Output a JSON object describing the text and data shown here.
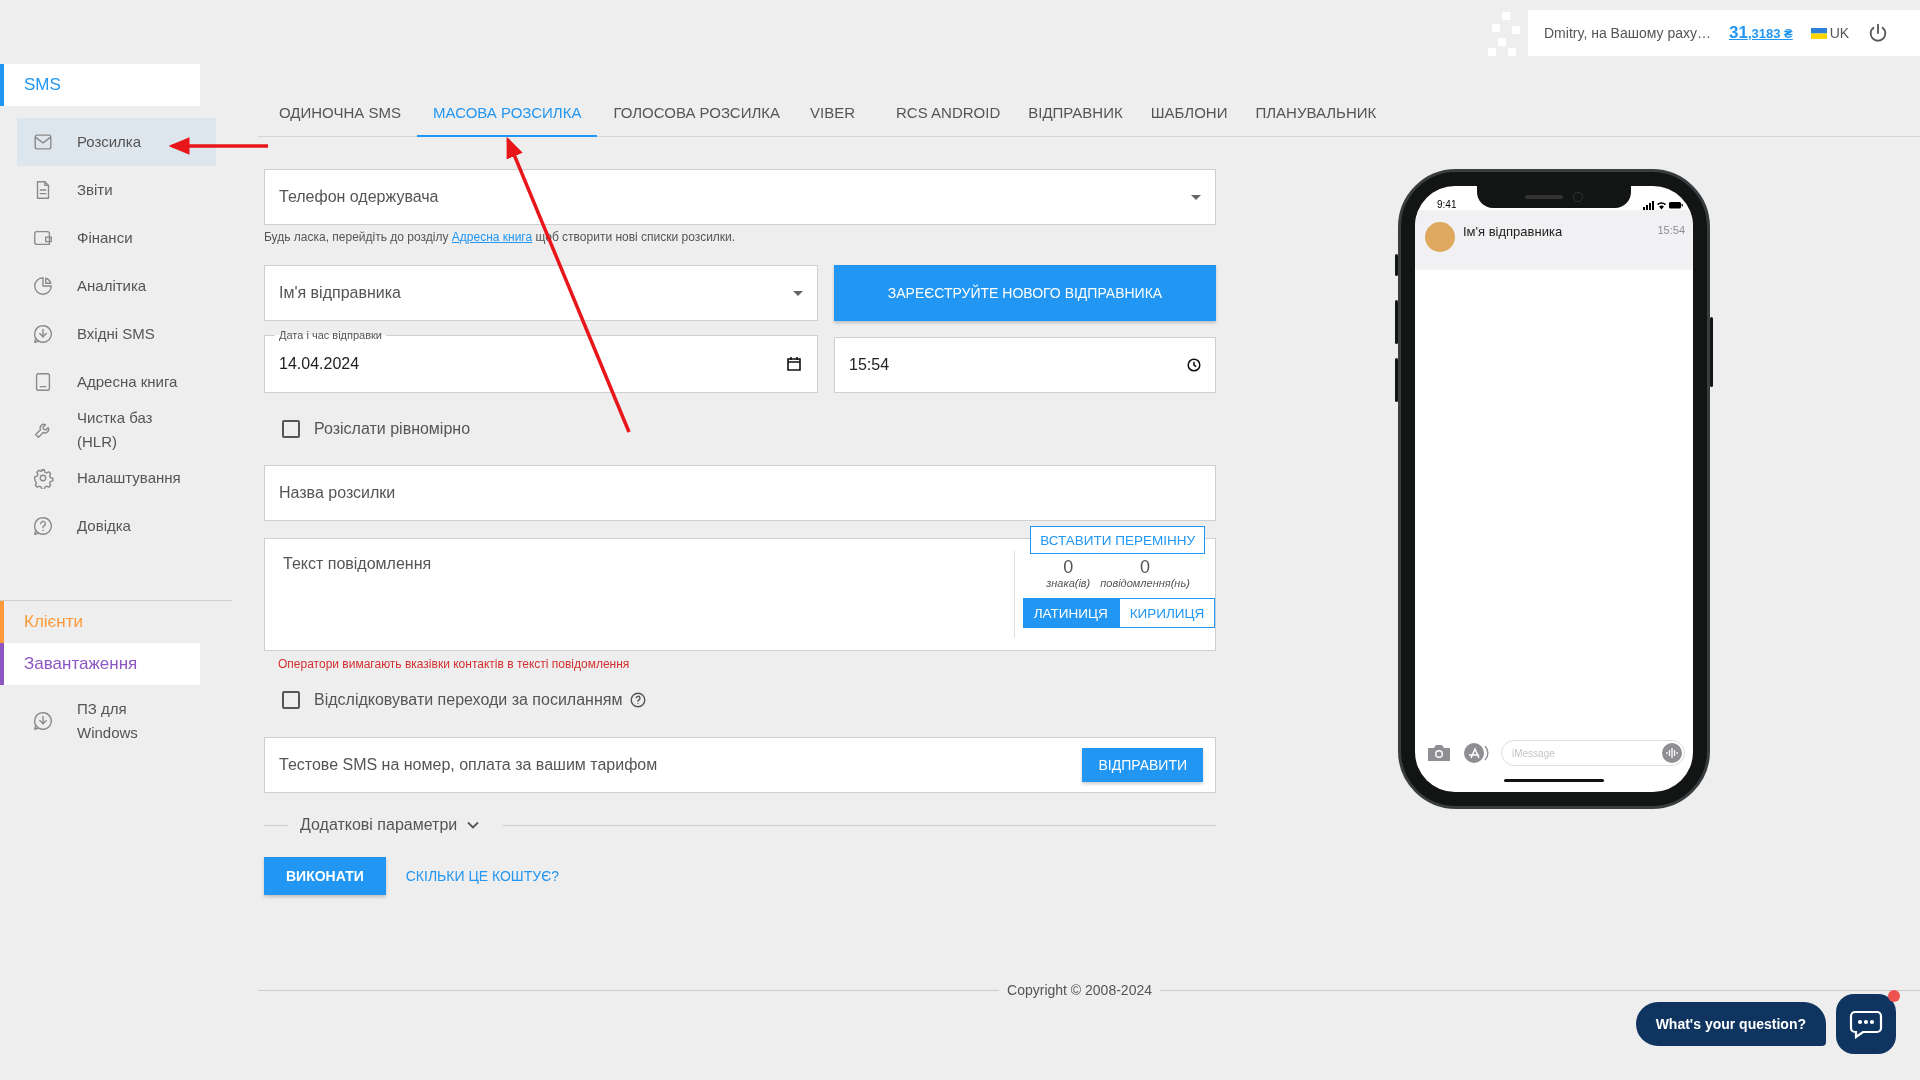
{
  "header": {
    "greeting": "Dmitry, на Вашому раху…",
    "balance_main": "31",
    "balance_rest": ",3183 ₴",
    "language": "UK"
  },
  "sidebar": {
    "sections": [
      {
        "title": "SMS",
        "color": "#2196f3",
        "expanded": true,
        "items": [
          {
            "label": "Розсилка",
            "selected": true
          },
          {
            "label": "Звіти",
            "selected": false
          },
          {
            "label": "Фінанси",
            "selected": false
          },
          {
            "label": "Аналітика",
            "selected": false
          },
          {
            "label": "Вхідні SMS",
            "selected": false
          },
          {
            "label": "Адресна книга",
            "selected": false
          },
          {
            "label": "Чистка баз (HLR)",
            "selected": false
          },
          {
            "label": "Налаштування",
            "selected": false
          },
          {
            "label": "Довідка",
            "selected": false
          }
        ]
      },
      {
        "title": "Клієнти",
        "color": "#ff9a3c",
        "expanded": false
      },
      {
        "title": "Завантаження",
        "color": "#8e56c2",
        "expanded": true,
        "items": [
          {
            "label": "ПЗ для Windows",
            "selected": false
          }
        ]
      }
    ]
  },
  "tabs": [
    {
      "label": "ОДИНОЧНА SMS",
      "selected": false
    },
    {
      "label": "МАСОВА РОЗСИЛКА",
      "selected": true
    },
    {
      "label": "ГОЛОСОВА РОЗСИЛКА",
      "selected": false
    },
    {
      "label": "VIBER",
      "selected": false
    },
    {
      "label": "RCS ANDROID",
      "selected": false
    },
    {
      "label": "ВІДПРАВНИК",
      "selected": false
    },
    {
      "label": "ШАБЛОНИ",
      "selected": false
    },
    {
      "label": "ПЛАНУВАЛЬНИК",
      "selected": false
    }
  ],
  "form": {
    "recipient": {
      "placeholder": "Телефон одержувача"
    },
    "hint": {
      "before": "Будь ласка, перейдіть до розділу ",
      "link": "Адресна книга",
      "after": " щоб створити нові списки розсилки."
    },
    "sender": {
      "placeholder": "Ім'я відправника"
    },
    "register_button": "ЗАРЕЄСТРУЙТЕ НОВОГО ВІДПРАВНИКА",
    "date": {
      "legend": "Дата і час відправки",
      "value": "14.04.2024"
    },
    "time": {
      "value": "15:54"
    },
    "even_send": {
      "label": "Розіслати рівномірно",
      "checked": false
    },
    "campaign_name": {
      "placeholder": "Назва розсилки"
    },
    "message": {
      "placeholder": "Текст повідомлення",
      "insert_variable": "ВСТАВИТИ ПЕРЕМІННУ",
      "counters": [
        {
          "value": "0",
          "label": "знака(ів)"
        },
        {
          "value": "0",
          "label": "повідомлення(нь)"
        }
      ],
      "alphabets": [
        {
          "label": "ЛАТИНИЦЯ",
          "selected": true
        },
        {
          "label": "КИРИЛИЦЯ",
          "selected": false
        }
      ]
    },
    "warning": "Оператори вимагають вказівки контактів в тексті повідомлення",
    "track_links": {
      "label": "Відслідковувати переходи за посиланням",
      "checked": false
    },
    "test_sms": {
      "placeholder": "Тестове SMS на номер, оплата за вашим тарифом",
      "button": "ВІДПРАВИТИ"
    },
    "extra": {
      "label": "Додаткові параметри",
      "expanded": false
    },
    "execute_button": "ВИКОНАТИ",
    "cost_link": "СКІЛЬКИ ЦЕ КОШТУЄ?"
  },
  "phone": {
    "status_time": "9:41",
    "sender": "Ім'я відправника",
    "time": "15:54",
    "input_placeholder": "iMessage"
  },
  "copyright": "Copyright © 2008-2024",
  "chat": {
    "prompt": "What's your question?",
    "unread": true
  }
}
